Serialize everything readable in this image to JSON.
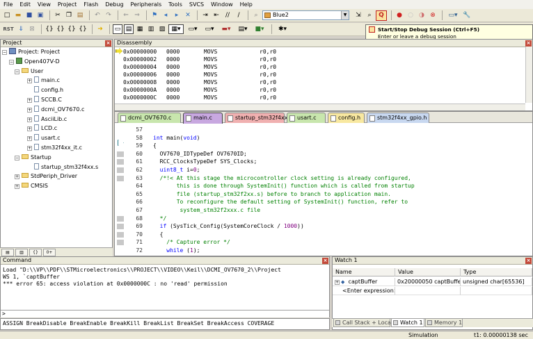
{
  "menu": [
    "File",
    "Edit",
    "View",
    "Project",
    "Flash",
    "Debug",
    "Peripherals",
    "Tools",
    "SVCS",
    "Window",
    "Help"
  ],
  "toolbar": {
    "target_name": "Blue2",
    "rst_label": "RST",
    "tooltip": {
      "title": "Start/Stop Debug Session (Ctrl+F5)",
      "desc": "Enter or leave a debug session"
    }
  },
  "project": {
    "title": "Project",
    "items": [
      {
        "label": "Project: Project",
        "level": 0
      },
      {
        "label": "Open407V-D",
        "level": 1
      },
      {
        "label": "User",
        "level": 2
      },
      {
        "label": "main.c",
        "level": 3
      },
      {
        "label": "config.h",
        "level": 3
      },
      {
        "label": "SCCB.C",
        "level": 3
      },
      {
        "label": "dcmi_OV7670.c",
        "level": 3
      },
      {
        "label": "AsciiLib.c",
        "level": 3
      },
      {
        "label": "LCD.c",
        "level": 3
      },
      {
        "label": "usart.c",
        "level": 3
      },
      {
        "label": "stm32f4xx_it.c",
        "level": 3
      },
      {
        "label": "Startup",
        "level": 2
      },
      {
        "label": "startup_stm32f4xx.s",
        "level": 3
      },
      {
        "label": "StdPeriph_Driver",
        "level": 2
      },
      {
        "label": "CMSIS",
        "level": 2
      }
    ]
  },
  "disassembly": {
    "title": "Disassembly",
    "lines": [
      {
        "addr": "0x00000000",
        "code": "0000",
        "op": "MOVS",
        "args": "r0,r0"
      },
      {
        "addr": "0x00000002",
        "code": "0000",
        "op": "MOVS",
        "args": "r0,r0"
      },
      {
        "addr": "0x00000004",
        "code": "0000",
        "op": "MOVS",
        "args": "r0,r0"
      },
      {
        "addr": "0x00000006",
        "code": "0000",
        "op": "MOVS",
        "args": "r0,r0"
      },
      {
        "addr": "0x00000008",
        "code": "0000",
        "op": "MOVS",
        "args": "r0,r0"
      },
      {
        "addr": "0x0000000A",
        "code": "0000",
        "op": "MOVS",
        "args": "r0,r0"
      },
      {
        "addr": "0x0000000C",
        "code": "0000",
        "op": "MOVS",
        "args": "r0,r0"
      }
    ]
  },
  "editor": {
    "tabs": [
      {
        "label": "dcmi_OV7670.c",
        "color": "#c8e6ad"
      },
      {
        "label": "main.c",
        "color": "#c8a8e0"
      },
      {
        "label": "startup_stm32f4xx.s",
        "color": "#f0b0b0"
      },
      {
        "label": "usart.c",
        "color": "#c8e6ad"
      },
      {
        "label": "config.h",
        "color": "#f8e8a0"
      },
      {
        "label": "stm32f4xx_gpio.h",
        "color": "#c8d8f0"
      }
    ],
    "lines": [
      {
        "n": "57",
        "text": ""
      },
      {
        "n": "58",
        "text": "int main(void)"
      },
      {
        "n": "59",
        "text": "{"
      },
      {
        "n": "60",
        "text": "  OV7670_IDTypeDef OV7670ID;"
      },
      {
        "n": "61",
        "text": "  RCC_ClocksTypeDef SYS_Clocks;"
      },
      {
        "n": "62",
        "text": "  uint8_t i=0;"
      },
      {
        "n": "63",
        "text": "  /*!< At this stage the microcontroller clock setting is already configured,"
      },
      {
        "n": "64",
        "text": "       this is done through SystemInit() function which is called from startup"
      },
      {
        "n": "65",
        "text": "       file (startup_stm32f2xx.s) before to branch to application main."
      },
      {
        "n": "66",
        "text": "       To reconfigure the default setting of SystemInit() function, refer to"
      },
      {
        "n": "67",
        "text": "        system_stm32f2xxx.c file"
      },
      {
        "n": "68",
        "text": "  */"
      },
      {
        "n": "69",
        "text": "  if (SysTick_Config(SystemCoreClock / 1000))"
      },
      {
        "n": "70",
        "text": "  {"
      },
      {
        "n": "71",
        "text": "    /* Capture error */"
      },
      {
        "n": "72",
        "text": "    while (1);"
      }
    ]
  },
  "command": {
    "title": "Command",
    "lines": [
      "Load \"D:\\\\VP\\\\PDF\\\\STMicroelectronics\\\\PROJECT\\\\VIDEO\\\\Keil\\\\DCMI_OV7670_2\\\\Project",
      "WS 1, `captBuffer",
      "*** error 65: access violation at 0x0000000C : no 'read' permission"
    ],
    "prompt": ">",
    "help": "ASSIGN BreakDisable BreakEnable BreakKill BreakList BreakSet BreakAccess COVERAGE"
  },
  "watch": {
    "title": "Watch 1",
    "headers": [
      "Name",
      "Value",
      "Type"
    ],
    "rows": [
      {
        "name": "captBuffer",
        "value": "0x20000050 captBuffer...",
        "type": "unsigned char[65536]"
      },
      {
        "name": "<Enter expression>",
        "value": "",
        "type": ""
      }
    ],
    "tabs": [
      "Call Stack + Locals",
      "Watch 1",
      "Memory 1"
    ]
  },
  "status": {
    "mode": "Simulation",
    "time": "t1: 0.00000138 sec"
  }
}
